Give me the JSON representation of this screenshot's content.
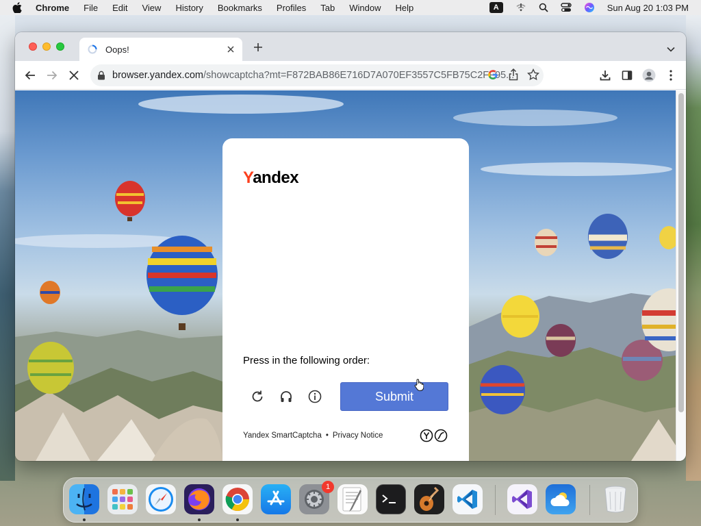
{
  "menubar": {
    "app_name": "Chrome",
    "items": [
      "File",
      "Edit",
      "View",
      "History",
      "Bookmarks",
      "Profiles",
      "Tab",
      "Window",
      "Help"
    ],
    "input_source": "A",
    "clock": "Sun Aug 20  1:03 PM"
  },
  "browser": {
    "tab": {
      "title": "Oops!"
    },
    "url": {
      "host": "browser.yandex.com",
      "path": "/showcaptcha?mt=F872BAB86E716D7A070EF3557C5FB75C2FF95..."
    }
  },
  "captcha": {
    "logo": {
      "first_letter": "Y",
      "rest": "andex"
    },
    "prompt": "Press in the following order:",
    "submit_label": "Submit",
    "footer": {
      "brand": "Yandex SmartCaptcha",
      "separator": "•",
      "privacy": "Privacy Notice"
    }
  },
  "dock": {
    "apps": [
      "Finder",
      "Launchpad",
      "Safari",
      "Firefox",
      "Google Chrome",
      "App Store",
      "System Settings",
      "TextEdit",
      "Terminal",
      "GarageBand",
      "Visual Studio Code",
      "Visual Studio",
      "Weather",
      "Trash"
    ],
    "system_settings_badge": "1"
  },
  "colors": {
    "yandex_red": "#fc3f1d",
    "submit_blue": "#5478d6",
    "tabbar_gray": "#dee1e6"
  }
}
